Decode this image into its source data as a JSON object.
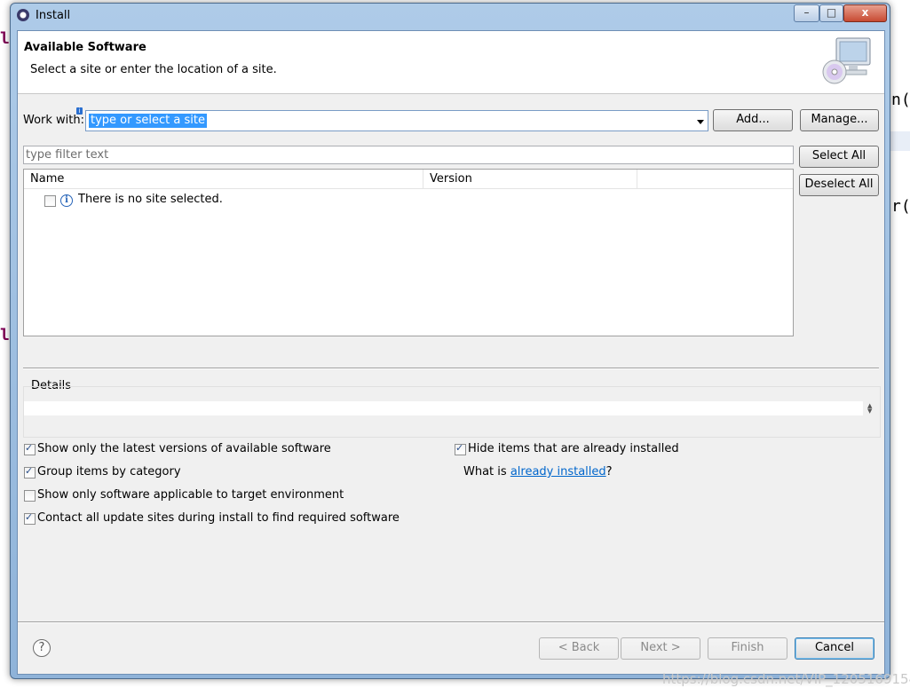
{
  "window": {
    "title": "Install",
    "min_label": "–",
    "max_label": "□",
    "close_label": "x"
  },
  "header": {
    "title": "Available Software",
    "description": "Select a site or enter the location of a site."
  },
  "work_with": {
    "label": "Work with:",
    "value": "type or select a site",
    "add_label": "Add...",
    "manage_label": "Manage..."
  },
  "filter": {
    "placeholder": "type filter text"
  },
  "side_buttons": {
    "select_all": "Select All",
    "deselect_all": "Deselect All"
  },
  "table": {
    "columns": [
      "Name",
      "Version"
    ],
    "rows": [
      {
        "name": "There is no site selected.",
        "checked": false
      }
    ]
  },
  "details": {
    "label": "Details"
  },
  "options": {
    "latest_versions": {
      "label": "Show only the latest versions of available software",
      "checked": true
    },
    "group_by_category": {
      "label": "Group items by category",
      "checked": true
    },
    "target_env": {
      "label": "Show only software applicable to target environment",
      "checked": false
    },
    "contact_sites": {
      "label": "Contact all update sites during install to find required software",
      "checked": true
    },
    "hide_installed": {
      "label": "Hide items that are already installed",
      "checked": true
    },
    "what_is_prefix": "What is ",
    "already_installed_link": "already installed",
    "what_is_suffix": "?"
  },
  "footer": {
    "help": "?",
    "back": "< Back",
    "next": "Next >",
    "finish": "Finish",
    "cancel": "Cancel"
  },
  "watermark": "https://blog.csdn.net/VIP_1205169154"
}
